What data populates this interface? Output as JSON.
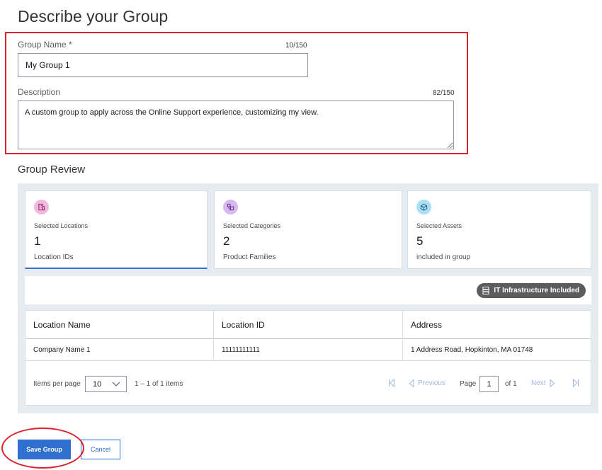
{
  "page": {
    "title": "Describe your Group"
  },
  "form": {
    "group_name_label": "Group Name *",
    "group_name_count": "10/150",
    "group_name_value": "My Group 1",
    "description_label": "Description",
    "description_count": "82/150",
    "description_value": "A custom group to apply across the Online Support experience, customizing my view."
  },
  "review": {
    "title": "Group Review",
    "cards": [
      {
        "icon": "building-icon",
        "label": "Selected Locations",
        "value": "1",
        "sub": "Location IDs",
        "color": "#f4b8de",
        "active": true
      },
      {
        "icon": "categories-icon",
        "label": "Selected Categories",
        "value": "2",
        "sub": "Product Families",
        "color": "#d8b8f2",
        "active": false
      },
      {
        "icon": "cube-icon",
        "label": "Selected Assets",
        "value": "5",
        "sub": "included in group",
        "color": "#a9def4",
        "active": false
      }
    ],
    "badge": {
      "icon": "server-icon",
      "label": "IT Infrastructure Included"
    }
  },
  "table": {
    "columns": [
      "Location Name",
      "Location ID",
      "Address"
    ],
    "rows": [
      [
        "Company Name 1",
        "11111111111",
        "1 Address Road, Hopkinton, MA 01748"
      ]
    ]
  },
  "pagination": {
    "items_per_page_label": "Items per page",
    "per_page_value": "10",
    "range_text": "1 – 1 of 1 items",
    "previous_label": "Previous",
    "page_label": "Page",
    "current_page": "1",
    "of_label": "of 1",
    "next_label": "Next"
  },
  "actions": {
    "save_label": "Save Group",
    "cancel_label": "Cancel"
  },
  "colors": {
    "accent": "#2f6fd0",
    "highlight": "#d9232d",
    "panel": "#e6ebf0"
  }
}
